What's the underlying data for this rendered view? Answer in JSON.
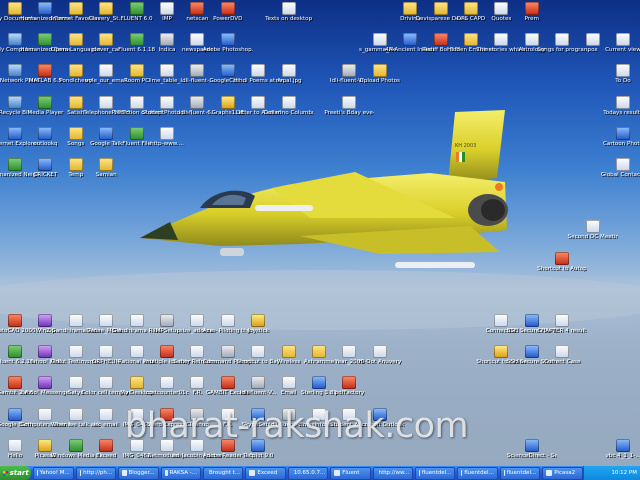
{
  "desktop_icons": [
    {
      "label": "My Documents",
      "type": "folder",
      "col": 0,
      "row": 0,
      "x": 0,
      "y": 0
    },
    {
      "label": "Humanized Connectio...",
      "type": "app3",
      "col": 1,
      "row": 0,
      "x": 31,
      "y": 0
    },
    {
      "label": "Internet Favorites",
      "type": "folder",
      "col": 2,
      "row": 0
    },
    {
      "label": "Clavery_St...",
      "type": "folder",
      "col": 3,
      "row": 0
    },
    {
      "label": "FLUENT 6.0",
      "type": "app1",
      "col": 4,
      "row": 0
    },
    {
      "label": "IMP",
      "type": "doc",
      "col": 5,
      "row": 0
    },
    {
      "label": "netscan",
      "type": "app2",
      "col": 6,
      "row": 0
    },
    {
      "label": "PowerDVD",
      "type": "app2",
      "col": 7,
      "row": 0
    },
    {
      "label": "Texts on desktop",
      "type": "doc",
      "col": 9,
      "row": 0
    },
    {
      "label": "Driving",
      "type": "folder",
      "col": 13,
      "row": 0
    },
    {
      "label": "Devisparese Devadasme...",
      "type": "folder",
      "col": 14,
      "row": 0
    },
    {
      "label": "DPS CAPD",
      "type": "folder",
      "col": 15,
      "row": 0
    },
    {
      "label": "Quotes",
      "type": "doc",
      "col": 16,
      "row": 0
    },
    {
      "label": "Prem",
      "type": "app2",
      "col": 17,
      "row": 0
    },
    {
      "label": "My Computer",
      "type": "sys",
      "col": 0,
      "row": 1
    },
    {
      "label": "Humanized Connectio...",
      "type": "app1",
      "col": 1,
      "row": 1
    },
    {
      "label": "Opera Languages",
      "type": "folder",
      "col": 2,
      "row": 1
    },
    {
      "label": "clever_car",
      "type": "folder",
      "col": 3,
      "row": 1
    },
    {
      "label": "Fluent 6.1.18",
      "type": "app1",
      "col": 4,
      "row": 1
    },
    {
      "label": "Indica",
      "type": "exe",
      "col": 5,
      "row": 1
    },
    {
      "label": "newspaper",
      "type": "doc",
      "col": 6,
      "row": 1
    },
    {
      "label": "Adobe Photoshop...",
      "type": "app3",
      "col": 7,
      "row": 1
    },
    {
      "label": "s_gamma_lik...",
      "type": "doc",
      "col": 12,
      "row": 1
    },
    {
      "label": "4A-Ancient Indian C...",
      "type": "app3",
      "col": 13,
      "row": 1
    },
    {
      "label": "Rediff Bol 6.0",
      "type": "app2",
      "col": 14,
      "row": 1
    },
    {
      "label": "Hidden Emotions",
      "type": "folder",
      "col": 15,
      "row": 1
    },
    {
      "label": "The stories which fo...",
      "type": "doc",
      "col": 16,
      "row": 1
    },
    {
      "label": "Astrology",
      "type": "doc",
      "col": 17,
      "row": 1
    },
    {
      "label": "Songs for program...",
      "type": "doc",
      "col": 18,
      "row": 1
    },
    {
      "label": "pox",
      "type": "doc",
      "col": 19,
      "row": 1
    },
    {
      "label": "Current view",
      "type": "doc",
      "col": 20,
      "row": 1
    },
    {
      "label": "My Network Places",
      "type": "sys",
      "col": 0,
      "row": 2
    },
    {
      "label": "MATLAB 6.5",
      "type": "app2",
      "col": 1,
      "row": 2
    },
    {
      "label": "Pondicherry",
      "type": "folder",
      "col": 2,
      "row": 2
    },
    {
      "label": "vole_our_email",
      "type": "doc",
      "col": 3,
      "row": 2
    },
    {
      "label": "Room PC",
      "type": "folder",
      "col": 4,
      "row": 2
    },
    {
      "label": "lime_table_...",
      "type": "doc",
      "col": 5,
      "row": 2
    },
    {
      "label": "Idli-fluent-...",
      "type": "exe",
      "col": 6,
      "row": 2
    },
    {
      "label": "GoogleCart...",
      "type": "app3",
      "col": 7,
      "row": 2
    },
    {
      "label": "Hindi Poems at AmdaHeal",
      "type": "doc",
      "col": 8,
      "row": 2
    },
    {
      "label": "nepal.jpg",
      "type": "doc",
      "col": 9,
      "row": 2
    },
    {
      "label": "Idli-fluent-VI...",
      "type": "exe",
      "col": 11,
      "row": 2
    },
    {
      "label": "Upload Photos",
      "type": "folder",
      "col": 12,
      "row": 2
    },
    {
      "label": "To Do",
      "type": "doc",
      "col": 20,
      "row": 2
    },
    {
      "label": "Recycle Bin",
      "type": "sys",
      "col": 0,
      "row": 3
    },
    {
      "label": "Media Player",
      "type": "app1",
      "col": 1,
      "row": 3
    },
    {
      "label": "Satish",
      "type": "folder",
      "col": 2,
      "row": 3
    },
    {
      "label": "Telephone 3DTH",
      "type": "doc",
      "col": 3,
      "row": 3
    },
    {
      "label": "Prediction of droplet sz...",
      "type": "doc",
      "col": 4,
      "row": 3
    },
    {
      "label": "StudentPhoto on (much...",
      "type": "doc",
      "col": 5,
      "row": 3
    },
    {
      "label": "Idli-fluent-6...",
      "type": "exe",
      "col": 6,
      "row": 3
    },
    {
      "label": "Graphs1.0E",
      "type": "app5",
      "col": 7,
      "row": 3
    },
    {
      "label": "Letter to Alumni",
      "type": "doc",
      "col": 8,
      "row": 3
    },
    {
      "label": "Dollarino Columbus Livic",
      "type": "doc",
      "col": 9,
      "row": 3
    },
    {
      "label": "Preeti's Bday eve-speech...",
      "type": "doc",
      "col": 11,
      "row": 3
    },
    {
      "label": "Todays results",
      "type": "doc",
      "col": 20,
      "row": 3
    },
    {
      "label": "Internet Explorer",
      "type": "app3",
      "col": 0,
      "row": 4
    },
    {
      "label": "outlookq",
      "type": "app3",
      "col": 1,
      "row": 4
    },
    {
      "label": "Songs",
      "type": "folder",
      "col": 2,
      "row": 4
    },
    {
      "label": "Google Talk",
      "type": "app3",
      "col": 3,
      "row": 4
    },
    {
      "label": "Fluent File",
      "type": "app1",
      "col": 4,
      "row": 4
    },
    {
      "label": "http-www....",
      "type": "doc",
      "col": 5,
      "row": 4
    },
    {
      "label": "Cartoon Photo",
      "type": "app3",
      "col": 20,
      "row": 4
    },
    {
      "label": "Humanized Neighborhood",
      "type": "app1",
      "col": 0,
      "row": 5
    },
    {
      "label": "CRICKET",
      "type": "app3",
      "col": 1,
      "row": 5
    },
    {
      "label": "Temp",
      "type": "folder",
      "col": 2,
      "row": 5
    },
    {
      "label": "Samian",
      "type": "folder",
      "col": 3,
      "row": 5
    },
    {
      "label": "Global Contacts",
      "type": "doc",
      "col": 20,
      "row": 5
    },
    {
      "label": "Second DC Meeting",
      "type": "doc",
      "col": 19,
      "row": 7
    },
    {
      "label": "Shortcut to Autopilot25...",
      "type": "app2",
      "col": 18,
      "row": 8
    },
    {
      "label": "AutoCAD 2000",
      "type": "app2",
      "col": 0,
      "row": 10
    },
    {
      "label": "WinZip",
      "type": "app4",
      "col": 1,
      "row": 10
    },
    {
      "label": "Gandhirama Ride",
      "type": "doc",
      "col": 2,
      "row": 10
    },
    {
      "label": "Dense_MOM...",
      "type": "doc",
      "col": 3,
      "row": 10
    },
    {
      "label": "Gandhirama Ride",
      "type": "doc",
      "col": 4,
      "row": 10
    },
    {
      "label": "IMPSetup",
      "type": "exe",
      "col": 5,
      "row": 10
    },
    {
      "label": "size_address",
      "type": "doc",
      "col": 6,
      "row": 10
    },
    {
      "label": "Ace - Piloting the India-F...",
      "type": "doc",
      "col": 7,
      "row": 10
    },
    {
      "label": "Joystick",
      "type": "app5",
      "col": 8,
      "row": 10
    },
    {
      "label": "ConnectDC",
      "type": "doc",
      "col": 16,
      "row": 10
    },
    {
      "label": "SSH Secure File Trans...",
      "type": "app3",
      "col": 17,
      "row": 10
    },
    {
      "label": "CHAPTER 4 result.html",
      "type": "doc",
      "col": 18,
      "row": 10
    },
    {
      "label": "Fluent 6.2.16",
      "type": "app1",
      "col": 0,
      "row": 11
    },
    {
      "label": "Yahoo! Mail",
      "type": "app4",
      "col": 1,
      "row": 11
    },
    {
      "label": "Orkut Testimonials",
      "type": "doc",
      "col": 2,
      "row": 11
    },
    {
      "label": "ORPHEUM",
      "type": "doc",
      "col": 3,
      "row": 11
    },
    {
      "label": "Rational Ride",
      "type": "doc",
      "col": 4,
      "row": 11
    },
    {
      "label": "multiple identity",
      "type": "app2",
      "col": 5,
      "row": 11
    },
    {
      "label": "Saher Refreshe...",
      "type": "doc",
      "col": 6,
      "row": 11
    },
    {
      "label": "Command Prompt",
      "type": "exe",
      "col": 7,
      "row": 11
    },
    {
      "label": "Shortcut to Bay",
      "type": "doc",
      "col": 8,
      "row": 11
    },
    {
      "label": "Wireless",
      "type": "folder",
      "col": 9,
      "row": 11
    },
    {
      "label": "Ashramme",
      "type": "folder",
      "col": 10,
      "row": 11
    },
    {
      "label": "Year_2009",
      "type": "doc",
      "col": 11,
      "row": 11
    },
    {
      "label": "Hi-Dot Anuvery",
      "type": "doc",
      "col": 12,
      "row": 11
    },
    {
      "label": "Shortcut to rsview",
      "type": "app5",
      "col": 16,
      "row": 11
    },
    {
      "label": "SSH Secure Shell Client",
      "type": "app3",
      "col": 17,
      "row": 11
    },
    {
      "label": "Current Case",
      "type": "doc",
      "col": 18,
      "row": 11
    },
    {
      "label": "Gambit 2.4.6",
      "type": "app2",
      "col": 0,
      "row": 12
    },
    {
      "label": "Yahoo! Messenger",
      "type": "app4",
      "col": 1,
      "row": 12
    },
    {
      "label": "Satya",
      "type": "doc",
      "col": 2,
      "row": 12
    },
    {
      "label": "Color cell template",
      "type": "doc",
      "col": 3,
      "row": 12
    },
    {
      "label": "My Desktop",
      "type": "folder",
      "col": 4,
      "row": 12
    },
    {
      "label": "costcounter01c",
      "type": "doc",
      "col": 5,
      "row": 12
    },
    {
      "label": "F.R.",
      "type": "doc",
      "col": 6,
      "row": 12
    },
    {
      "label": "GAMBIT Exceed",
      "type": "app2",
      "col": 7,
      "row": 12
    },
    {
      "label": "Idli-fluent-V...",
      "type": "exe",
      "col": 8,
      "row": 12
    },
    {
      "label": "Email",
      "type": "doc",
      "col": 9,
      "row": 12
    },
    {
      "label": "Sterling 3.89",
      "type": "app3",
      "col": 10,
      "row": 12
    },
    {
      "label": "pdfFactory",
      "type": "app2",
      "col": 11,
      "row": 12
    },
    {
      "label": "Google Earth",
      "type": "app3",
      "col": 0,
      "row": 13
    },
    {
      "label": "Computers Near My House",
      "type": "doc",
      "col": 1,
      "row": 13
    },
    {
      "label": "When we talk about the In...",
      "type": "doc",
      "col": 2,
      "row": 13
    },
    {
      "label": "ek_email",
      "type": "doc",
      "col": 3,
      "row": 13
    },
    {
      "label": "IMG_0455",
      "type": "doc",
      "col": 4,
      "row": 13
    },
    {
      "label": "Nero Express",
      "type": "app2",
      "col": 5,
      "row": 13
    },
    {
      "label": "Cleanup",
      "type": "exe",
      "col": 6,
      "row": 13
    },
    {
      "label": "F.R.",
      "type": "doc",
      "col": 7,
      "row": 13
    },
    {
      "label": "SkypeSetup",
      "type": "app3",
      "col": 8,
      "row": 13
    },
    {
      "label": "Idli-fluent-VI...",
      "type": "exe",
      "col": 9,
      "row": 13
    },
    {
      "label": "timesinfotec...",
      "type": "doc",
      "col": 10,
      "row": 13
    },
    {
      "label": "Student_res...",
      "type": "doc",
      "col": 11,
      "row": 13
    },
    {
      "label": "Microsoft Outlook",
      "type": "app3",
      "col": 12,
      "row": 13
    },
    {
      "label": "Hello",
      "type": "doc",
      "col": 0,
      "row": 14
    },
    {
      "label": "Picasa2",
      "type": "app5",
      "col": 1,
      "row": 14
    },
    {
      "label": "Windows Media Player",
      "type": "app1",
      "col": 2,
      "row": 14
    },
    {
      "label": "Exceed",
      "type": "app2",
      "col": 3,
      "row": 14
    },
    {
      "label": "IMG_0462",
      "type": "doc",
      "col": 4,
      "row": 14
    },
    {
      "label": "Netmodules...",
      "type": "doc",
      "col": 5,
      "row": 14
    },
    {
      "label": "ed-Jacobin Journal 2...",
      "type": "doc",
      "col": 6,
      "row": 14
    },
    {
      "label": "Adobe Reader 7.0",
      "type": "app2",
      "col": 7,
      "row": 14
    },
    {
      "label": "Tecplot 9.0",
      "type": "app3",
      "col": 8,
      "row": 14
    },
    {
      "label": "ScienceDirect - Search Res...",
      "type": "app3",
      "col": 17,
      "row": 14
    },
    {
      "label": "vbc 4_1_1-...",
      "type": "app3",
      "col": 20,
      "row": 14
    }
  ],
  "wallpaper": {
    "aircraft_serial": "KH 2003"
  },
  "watermark": "bharat-rakshak.com",
  "taskbar": {
    "start_label": "start",
    "buttons": [
      "Yahoo! M...",
      "http://ph...",
      "Blogger...",
      "RAKSA -...",
      "Brought t...",
      "Exceed",
      "10.65.0.7...",
      "Fluent",
      "http://ww...",
      "fluentdel...",
      "fluentdel...",
      "fluentdel...",
      "Picasa2"
    ],
    "clock": "10:12 PM"
  }
}
